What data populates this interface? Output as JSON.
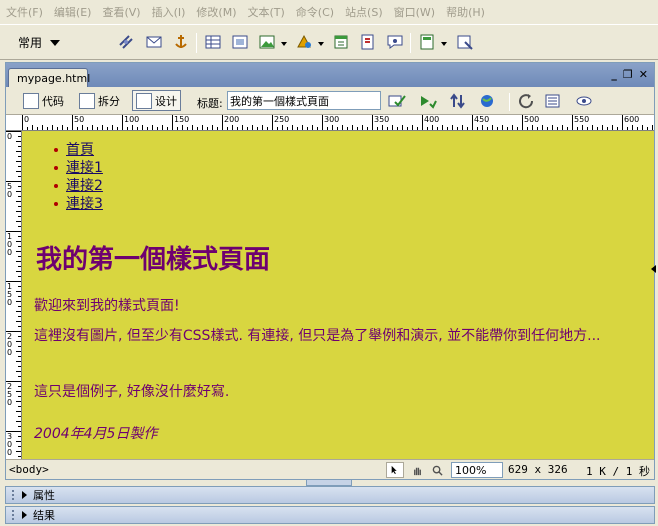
{
  "menu": [
    "文件(F)",
    "编辑(E)",
    "查看(V)",
    "插入(I)",
    "修改(M)",
    "文本(T)",
    "命令(C)",
    "站点(S)",
    "窗口(W)",
    "帮助(H)"
  ],
  "insert_bar": {
    "category": "常用"
  },
  "document": {
    "tab": "mypage.html",
    "views": {
      "code": "代码",
      "split": "拆分",
      "design": "设计"
    },
    "title_label": "标题:",
    "title_value": "我的第一個樣式頁面"
  },
  "ruler": {
    "h_ticks": [
      "0",
      "50",
      "100",
      "150",
      "200",
      "250",
      "300",
      "350",
      "400",
      "450",
      "500",
      "550",
      "600"
    ],
    "v_ticks": [
      "0",
      "50",
      "100",
      "150",
      "200",
      "250",
      "300"
    ]
  },
  "page": {
    "nav": [
      "首頁",
      "連接1",
      "連接2",
      "連接3"
    ],
    "heading": "我的第一個樣式頁面",
    "paragraphs": [
      "歡迎來到我的樣式頁面!",
      "這裡沒有圖片, 但至少有CSS樣式. 有連接, 但只是為了舉例和演示, 並不能帶你到任何地方...",
      "這只是個例子, 好像沒什麼好寫."
    ],
    "footer": "2004年4月5日製作",
    "colors": {
      "background": "#d8d640",
      "text": "#6e0070",
      "link": "#1a0a66"
    }
  },
  "status": {
    "tag": "<body>",
    "zoom": "100%",
    "size": "629 x 326",
    "weight": "1 K / 1 秒"
  },
  "panels": [
    "属性",
    "结果"
  ]
}
